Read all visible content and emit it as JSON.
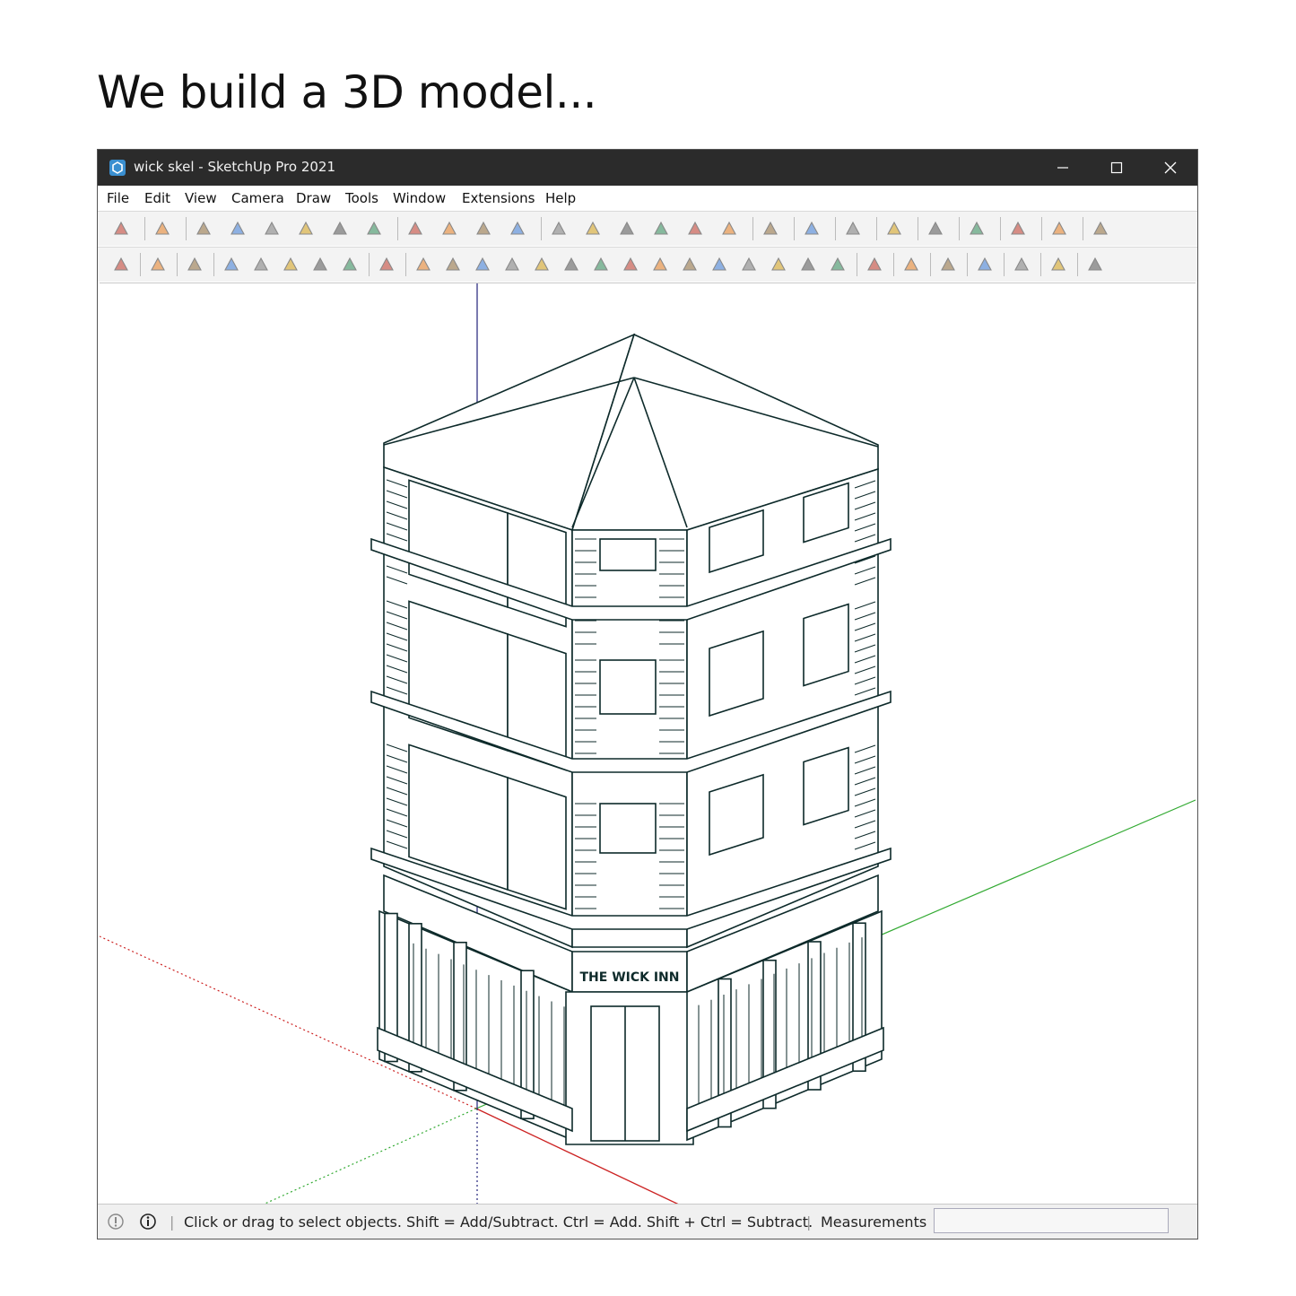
{
  "headline": "We build a 3D model...",
  "window": {
    "title": "wick skel - SketchUp Pro 2021",
    "controls": [
      "minimize",
      "maximize",
      "close"
    ]
  },
  "menu": [
    "File",
    "Edit",
    "View",
    "Camera",
    "Draw",
    "Tools",
    "Window",
    "Extensions",
    "Help"
  ],
  "toolbar_icons_row1": [
    "polygon-icon",
    "pencil-icon",
    "push-pull-icon",
    "orbit-icon",
    "rotate-icon",
    "follow-me-icon",
    "offset-icon",
    "shape-icon",
    "paint-icon",
    "tape-icon",
    "protractor-icon",
    "eraser-icon",
    "select-icon",
    "move-icon",
    "push-icon",
    "rotate-red-icon",
    "scale-icon",
    "paint-bucket-icon",
    "pen-icon",
    "pen2-icon",
    "house-icon",
    "section-icon",
    "arc-icon",
    "dimension-icon",
    "target-icon",
    "component-icon",
    "camera-icon"
  ],
  "toolbar_icons_row2": [
    "check-icon",
    "box-icon",
    "cube-icon",
    "sandbox-icon",
    "sandbox2-icon",
    "sandbox3-icon",
    "sandbox4-icon",
    "sandbox5-icon",
    "layers-icon",
    "cube-shape-icon",
    "cylinder-icon",
    "prism-icon",
    "pyramid-icon",
    "tube-icon",
    "circle-icon",
    "cone-icon",
    "drop-icon",
    "ellipse-icon",
    "lens-icon",
    "torus-icon",
    "dodeca-icon",
    "sphere-icon",
    "geo-icon",
    "gem-icon",
    "magnet-icon",
    "color-cube-icon",
    "color-cube2-icon",
    "gradient-icon",
    "stack-icon",
    "stair-icon",
    "arrow-up-icon"
  ],
  "colors": {
    "titlebar": "#2b2b2b",
    "model_lines": "#0d2a2a",
    "axis_red": "#cc2222",
    "axis_green": "#33aa33",
    "axis_blue": "#22227a"
  },
  "model": {
    "sign_text": "THE WICK INN"
  },
  "status": {
    "hint": "Click or drag to select objects. Shift = Add/Subtract. Ctrl = Add. Shift + Ctrl = Subtract.",
    "measurements_label": "Measurements",
    "measurements_value": ""
  }
}
